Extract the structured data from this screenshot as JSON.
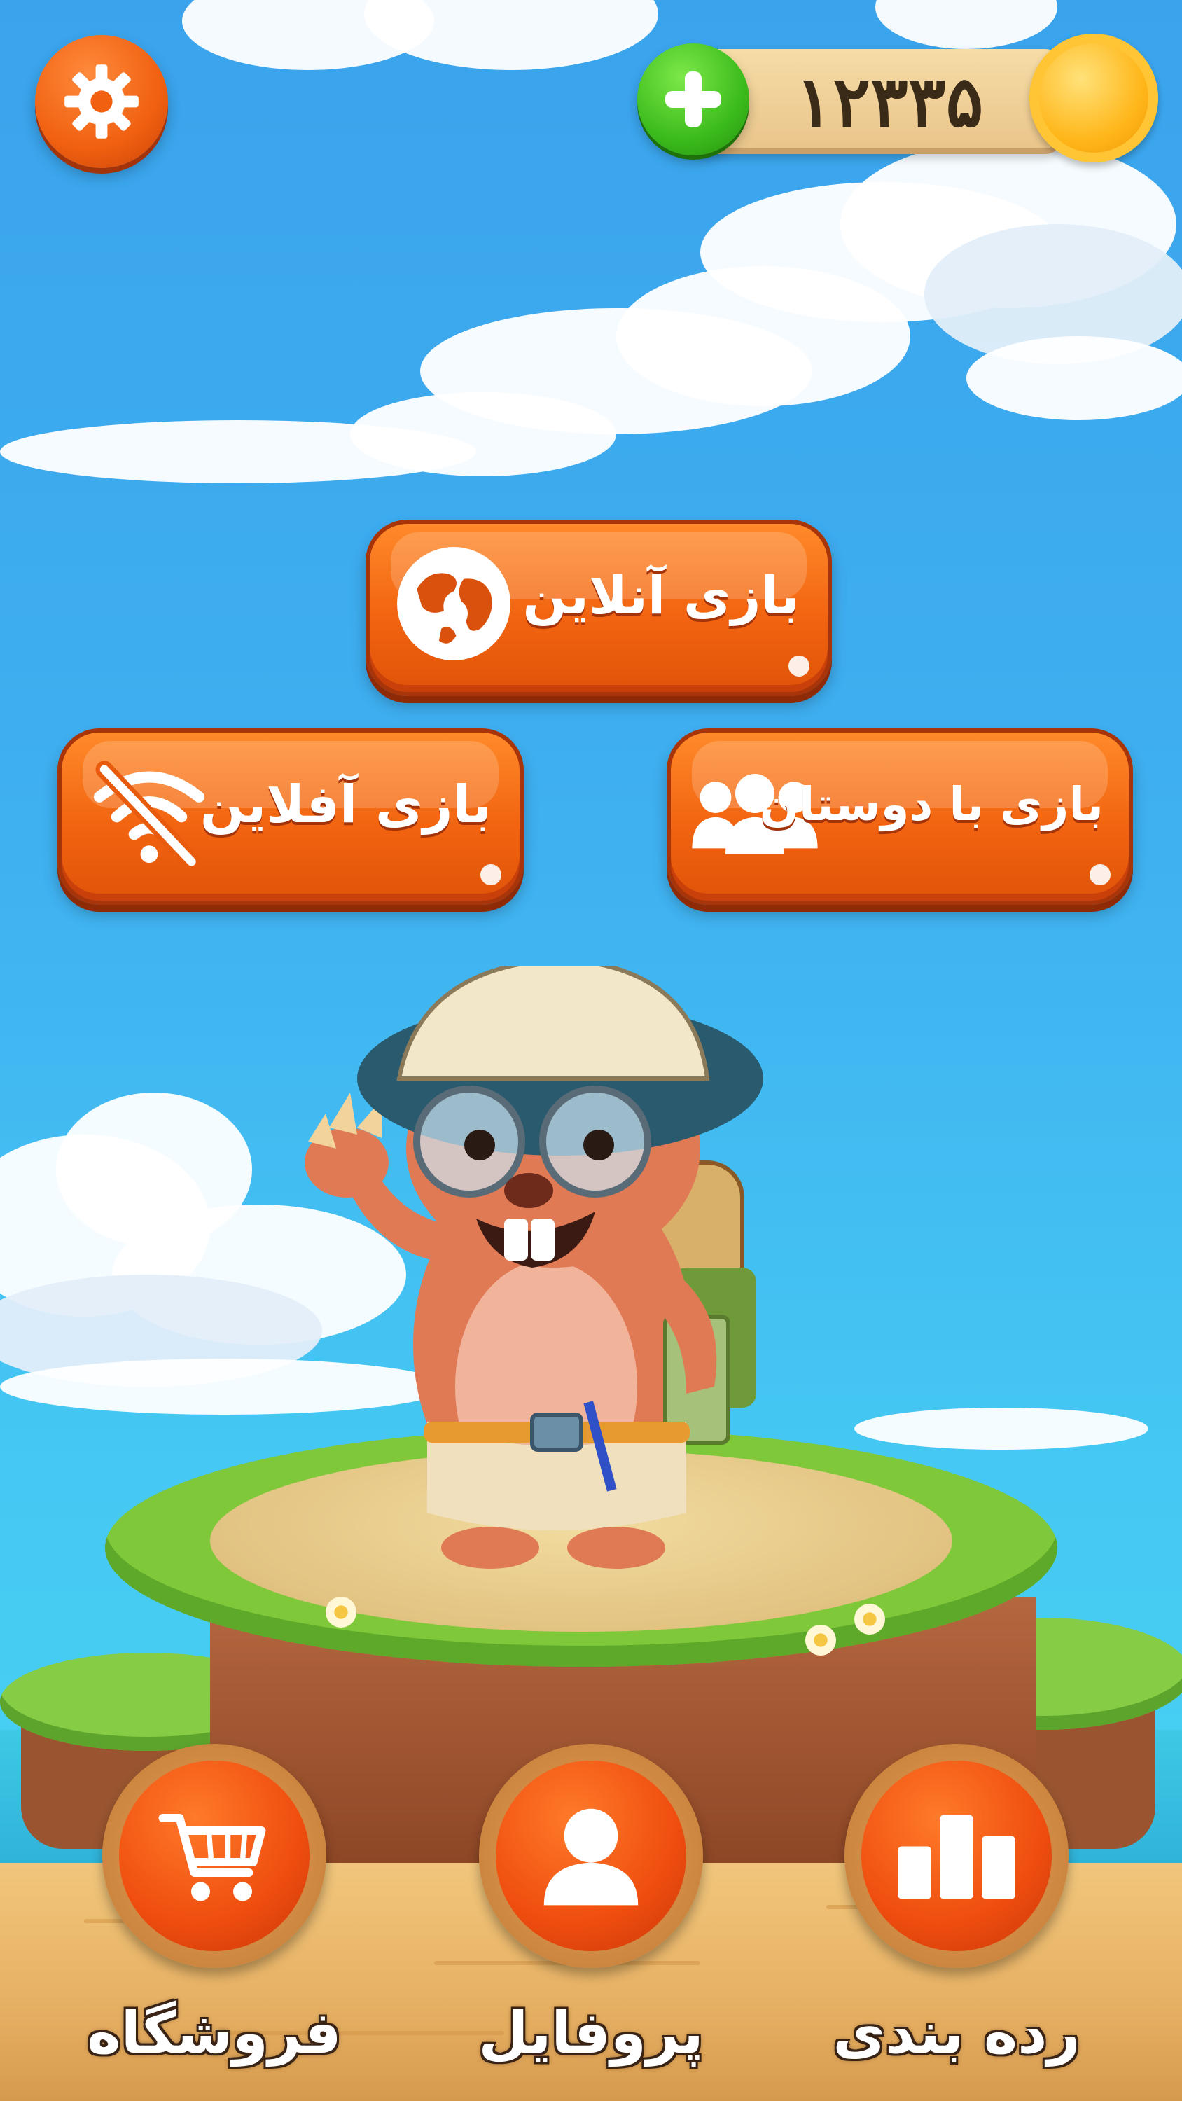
{
  "coins": {
    "value": "۱۲۳۳۵"
  },
  "icons": {
    "settings": "gear-icon",
    "add_coins": "plus-icon",
    "coin": "coin-icon",
    "online": "globe-icon",
    "friends": "group-icon",
    "offline": "wifi-off-icon",
    "shop": "cart-icon",
    "profile": "user-icon",
    "leaderboard": "bar-chart-icon"
  },
  "menu": {
    "online_label": "بازی آنلاین",
    "friends_label": "بازی با دوستان",
    "offline_label": "بازی آفلاین"
  },
  "bottom_nav": {
    "shop_label": "فروشگاه",
    "profile_label": "پروفایل",
    "leaderboard_label": "رده بندی"
  },
  "colors": {
    "button_orange": "#f26410",
    "plus_green": "#3cbc1c",
    "coin_gold": "#ffb619",
    "sky_blue": "#3aa3ec"
  }
}
